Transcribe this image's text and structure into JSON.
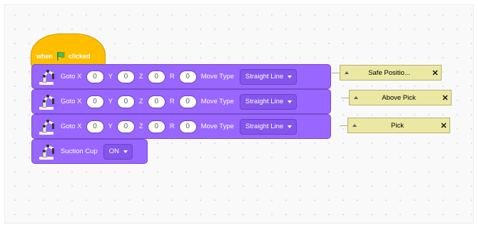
{
  "hat": {
    "when": "when",
    "clicked": "clicked",
    "flag_icon": "green-flag-icon",
    "color": "#ffbf00"
  },
  "blocks": [
    {
      "label": "Goto X",
      "x": "0",
      "y_label": "Y",
      "y": "0",
      "z_label": "Z",
      "z": "0",
      "r_label": "R",
      "r": "0",
      "move_label": "Move Type",
      "move_type": "Straight Line",
      "note": "Safe Positio..."
    },
    {
      "label": "Goto X",
      "x": "0",
      "y_label": "Y",
      "y": "0",
      "z_label": "Z",
      "z": "0",
      "r_label": "R",
      "r": "0",
      "move_label": "Move Type",
      "move_type": "Straight Line",
      "note": "Above Pick"
    },
    {
      "label": "Goto X",
      "x": "0",
      "y_label": "Y",
      "y": "0",
      "z_label": "Z",
      "z": "0",
      "r_label": "R",
      "r": "0",
      "move_label": "Move Type",
      "move_type": "Straight Line",
      "note": "Pick"
    }
  ],
  "suction": {
    "label": "Suction Cup",
    "state": "ON"
  },
  "icons": {
    "robot": "robot-arm-icon",
    "close": "close-icon",
    "collapse": "collapse-triangle-icon"
  },
  "colors": {
    "block": "#9966ff",
    "block_border": "#774dcb",
    "note": "#ebe8a3"
  }
}
